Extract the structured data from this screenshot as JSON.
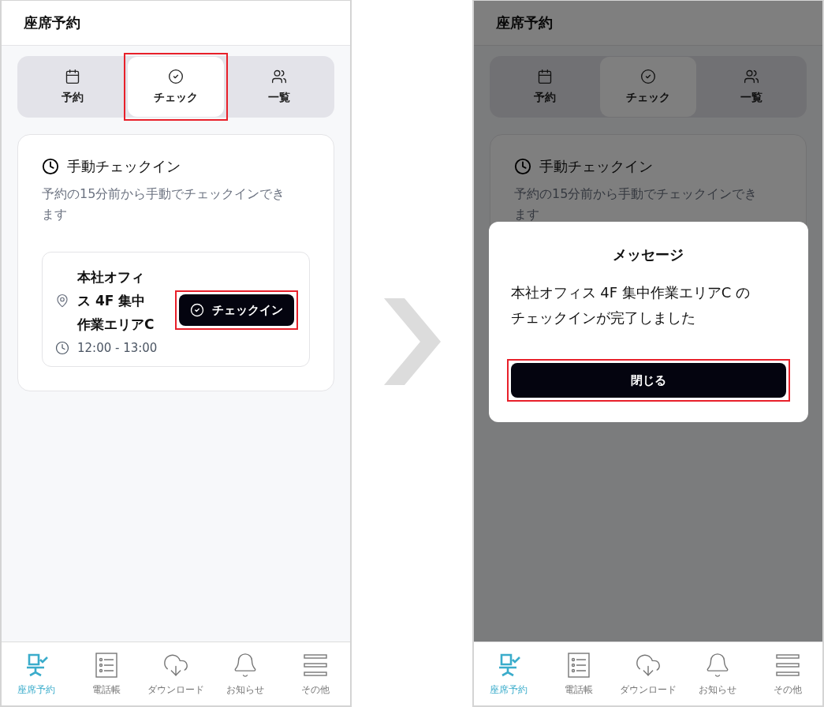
{
  "screens": [
    {
      "header": {
        "title": "座席予約"
      },
      "tabs": [
        {
          "label": "予約",
          "selected": false,
          "highlighted": false
        },
        {
          "label": "チェック",
          "selected": true,
          "highlighted": true
        },
        {
          "label": "一覧",
          "selected": false,
          "highlighted": false
        }
      ],
      "card": {
        "heading": "手動チェックイン",
        "description": "予約の15分前から手動でチェックインできます",
        "reservations": [
          {
            "location": "本社オフィス 4F 集中作業エリアC",
            "time": "12:00 - 13:00",
            "button": {
              "label": "チェックイン",
              "highlighted": true
            }
          }
        ]
      },
      "nav": [
        {
          "label": "座席予約",
          "selected": true
        },
        {
          "label": "電話帳",
          "selected": false
        },
        {
          "label": "ダウンロード",
          "selected": false
        },
        {
          "label": "お知らせ",
          "selected": false
        },
        {
          "label": "その他",
          "selected": false
        }
      ]
    },
    {
      "header": {
        "title": "座席予約"
      },
      "tabs": [
        {
          "label": "予約",
          "selected": false,
          "highlighted": false
        },
        {
          "label": "チェック",
          "selected": true,
          "highlighted": false
        },
        {
          "label": "一覧",
          "selected": false,
          "highlighted": false
        }
      ],
      "card": {
        "heading": "手動チェックイン",
        "description": "予約の15分前から手動でチェックインできます"
      },
      "nav": [
        {
          "label": "座席予約",
          "selected": true
        },
        {
          "label": "電話帳",
          "selected": false
        },
        {
          "label": "ダウンロード",
          "selected": false
        },
        {
          "label": "お知らせ",
          "selected": false
        },
        {
          "label": "その他",
          "selected": false
        }
      ],
      "dialog": {
        "title": "メッセージ",
        "message": "本社オフィス 4F 集中作業エリアC のチェックインが完了しました",
        "button": {
          "label": "閉じる",
          "highlighted": true
        }
      }
    }
  ]
}
